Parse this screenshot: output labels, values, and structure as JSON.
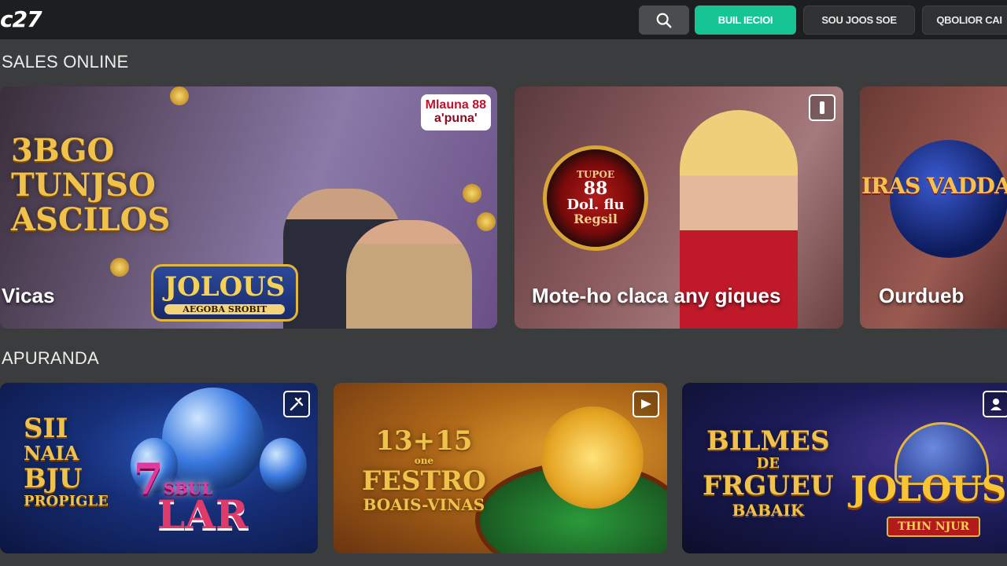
{
  "header": {
    "logo": "c27",
    "search_icon": "search-icon",
    "btn_primary": "BUIL IECIOI",
    "btn_secondary": "SOU JOOS SOE",
    "btn_third": "QBOLIOR CAI"
  },
  "sections": [
    {
      "title": "SALES ONLINE"
    },
    {
      "title": "APURANDA"
    }
  ],
  "cards_row1": [
    {
      "caption": "Vicas",
      "art_lines": [
        "3BGO",
        "TUNJSO",
        "ASCILOS"
      ],
      "logo_main": "JOLOUS",
      "logo_sub": "AEGOBA SROBIT",
      "tag_line1": "Mlauna 88",
      "tag_line2": "a'puna'"
    },
    {
      "caption": "Mote-ho claca any giques",
      "roulette_top": "TUPOE",
      "roulette_mid1": "88",
      "roulette_mid2": "Dol. flu",
      "roulette_bot": "Regsil",
      "icon": "bookmark-icon"
    },
    {
      "caption": "Ourdueb",
      "art_text": "IRAS VADDA"
    }
  ],
  "cards_row2": [
    {
      "art_lines": [
        "SII",
        "NAIA",
        "BJU"
      ],
      "art_small": "PROPIGLE",
      "seven": "7",
      "seven_small": "SBUL",
      "seven_sub": "LAR",
      "icon": "tool-icon"
    },
    {
      "art_lines": [
        "13+15",
        "FESTRO"
      ],
      "art_small_top": "one",
      "art_small": "BOAIS-VINAS",
      "icon": "play-icon"
    },
    {
      "art_lines": [
        "BILMES",
        "FRGUEU"
      ],
      "art_small_top": "DE",
      "art_small": "BABAIK",
      "logo_main": "JOLOUS",
      "logo_sub": "THIN NJUR",
      "icon": "profile-icon"
    }
  ],
  "colors": {
    "background": "#3a3c3d",
    "topbar": "#1d1e20",
    "accent": "#17c493",
    "gold_text": "#f0c24a"
  }
}
